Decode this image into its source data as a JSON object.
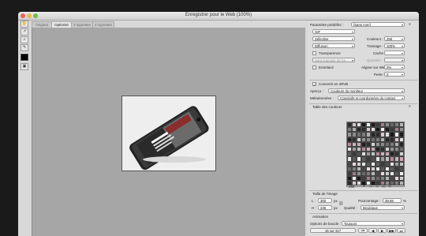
{
  "window": {
    "title": "Enregistrer pour le Web (100%)",
    "controls": {
      "close_color": "#ec6559",
      "min_color": "#e1c04c",
      "max_color": "#71bd47"
    }
  },
  "tabs": [
    {
      "label": "Original"
    },
    {
      "label": "Optimisé"
    },
    {
      "label": "2 vignettes"
    },
    {
      "label": "4 vignettes"
    }
  ],
  "tools": [
    "hand-icon",
    "slice-select-icon",
    "zoom-icon",
    "eyedropper-icon",
    "color-swatch",
    "toggle-slices-icon"
  ],
  "settings": {
    "preset_label": "Paramètre prédéfini :",
    "preset_value": "[Sans nom]",
    "format_value": "GIF",
    "reduction_value": "Sélective",
    "colors_label": "Couleurs :",
    "colors_value": "256",
    "dither_value": "Diffusion",
    "dither_amount_label": "Tramage :",
    "dither_amount_value": "100%",
    "transparency_label": "Transparence",
    "matte_label": "Cache :",
    "transparency_dither_value": "Sans tramage de tra...",
    "amount_label": "Quantité :",
    "interlaced_label": "Entrelacé",
    "web_snap_label": "Aligner sur Web :",
    "web_snap_value": "0%",
    "lossy_label": "Perte :",
    "lossy_value": "0",
    "convert_srgb_label": "Convertir en sRVB",
    "preview_label": "Aperçu :",
    "preview_value": "Couleurs du moniteur",
    "metadata_label": "Métadonnées :",
    "metadata_value": "Copyright et coordonnées du contact"
  },
  "color_table": {
    "title": "Table des couleurs",
    "count": "256",
    "colors": [
      "#2b2b2b",
      "#8a8a8a",
      "#c9a9b0",
      "#e2e2e2",
      "#5a5a5a",
      "#b7b7b7",
      "#3c3c3c",
      "#d8c7cc",
      "#6f6f6f",
      "#1e1e1e",
      "#9c9c9c",
      "#f0f0f0",
      "#4a4a4a",
      "#a87c86",
      "#dedede",
      "#7b7b7b",
      "#2f2f2f",
      "#c2c2c2",
      "#5f5f5f",
      "#e9d9de",
      "#8f8f8f",
      "#161616",
      "#b0b0b0",
      "#d2d2d2",
      "#b88996",
      "#3a3a3a",
      "#cfcfcf",
      "#6a6a6a",
      "#efefef",
      "#262626",
      "#949494",
      "#c7b3b8",
      "#505050",
      "#e5e5e5",
      "#7f7f7f",
      "#1a1a1a"
    ]
  },
  "image_size": {
    "title": "Taille de l'image",
    "w_label": "L :",
    "w_value": "300",
    "h_label": "H :",
    "h_value": "236",
    "unit": "px",
    "percent_label": "Pourcentage :",
    "percent_value": "39,89",
    "percent_unit": "%",
    "quality_label": "Qualité :",
    "quality_value": "Bicubique"
  },
  "animation": {
    "title": "Animation",
    "loop_label": "Options de boucle :",
    "loop_value": "Toujours",
    "frame_counter": "15 sur 317"
  }
}
